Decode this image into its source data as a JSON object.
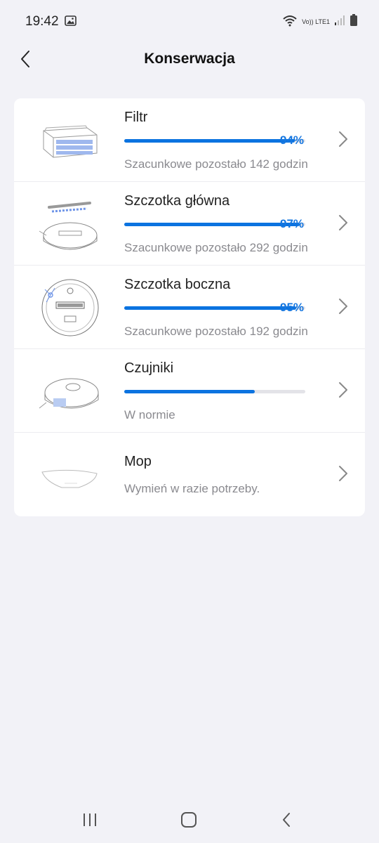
{
  "status_bar": {
    "time": "19:42",
    "network_label": "Vo)) LTE1",
    "icons": [
      "photo-icon",
      "wifi-icon",
      "signal-icon",
      "battery-icon"
    ]
  },
  "header": {
    "title": "Konserwacja",
    "back_icon": "chevron-left-icon"
  },
  "items": [
    {
      "title": "Filtr",
      "progress_percent": 94,
      "percent_label": "94%",
      "subtitle": "Szacunkowe pozostało 142 godzin",
      "image": "filter-image"
    },
    {
      "title": "Szczotka główna",
      "progress_percent": 97,
      "percent_label": "97%",
      "subtitle": "Szacunkowe pozostało 292 godzin",
      "image": "main-brush-image"
    },
    {
      "title": "Szczotka boczna",
      "progress_percent": 95,
      "percent_label": "95%",
      "subtitle": "Szacunkowe pozostało 192 godzin",
      "image": "side-brush-image"
    },
    {
      "title": "Czujniki",
      "progress_percent": 72,
      "percent_label": "",
      "subtitle": "W normie",
      "image": "sensors-image"
    },
    {
      "title": "Mop",
      "subtitle": "Wymień w razie potrzeby.",
      "image": "mop-image"
    }
  ],
  "colors": {
    "accent": "#0b73e0",
    "percent_text": "#1677e0",
    "background": "#f2f2f7",
    "card": "#ffffff",
    "subtitle_text": "#8a8a8f"
  },
  "nav_bar": {
    "buttons": [
      "recent-apps-icon",
      "home-icon",
      "back-icon"
    ]
  }
}
